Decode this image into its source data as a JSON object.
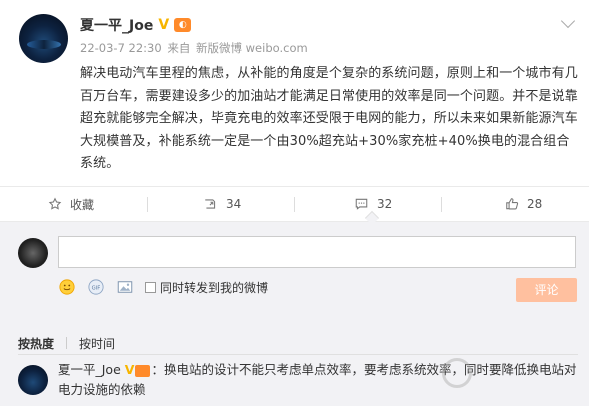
{
  "author": {
    "name": "夏一平_Joe",
    "verified_mark": "V"
  },
  "meta": {
    "time": "22-03-7 22:30",
    "source_prefix": "来自",
    "source": "新版微博 weibo.com"
  },
  "post": {
    "text": "解决电动汽车里程的焦虑，从补能的角度是个复杂的系统问题，原则上和一个城市有几百万台车，需要建设多少的加油站才能满足日常使用的效率是同一个问题。并不是说靠超充就能够完全解决，毕竟充电的效率还受限于电网的能力，所以未来如果新能源汽车大规模普及，补能系统一定是一个由30%超充站+30%家充桩+40%换电的混合组合系统。"
  },
  "actions": {
    "favorite_label": "收藏",
    "repost_count": "34",
    "comment_count": "32",
    "like_count": "28"
  },
  "composer": {
    "repost_option_label": "同时转发到我的微博",
    "submit_label": "评论"
  },
  "sort": {
    "hot_label": "按热度",
    "time_label": "按时间"
  },
  "comment": {
    "author": "夏一平_Joe",
    "verified_mark": "V",
    "text": "：换电站的设计不能只考虑单点效率，要考虑系统效率，同时要降低换电站对电力设施的依赖"
  },
  "icons": {
    "favorite": "star-icon",
    "repost": "repost-icon",
    "comment": "comment-icon",
    "like": "thumbs-up-icon",
    "emoji": "emoji-icon",
    "gif": "gif-icon",
    "image": "image-icon"
  },
  "colors": {
    "accent": "#ff8200",
    "submit_disabled": "#ffc09f",
    "verified": "#f7b500"
  }
}
